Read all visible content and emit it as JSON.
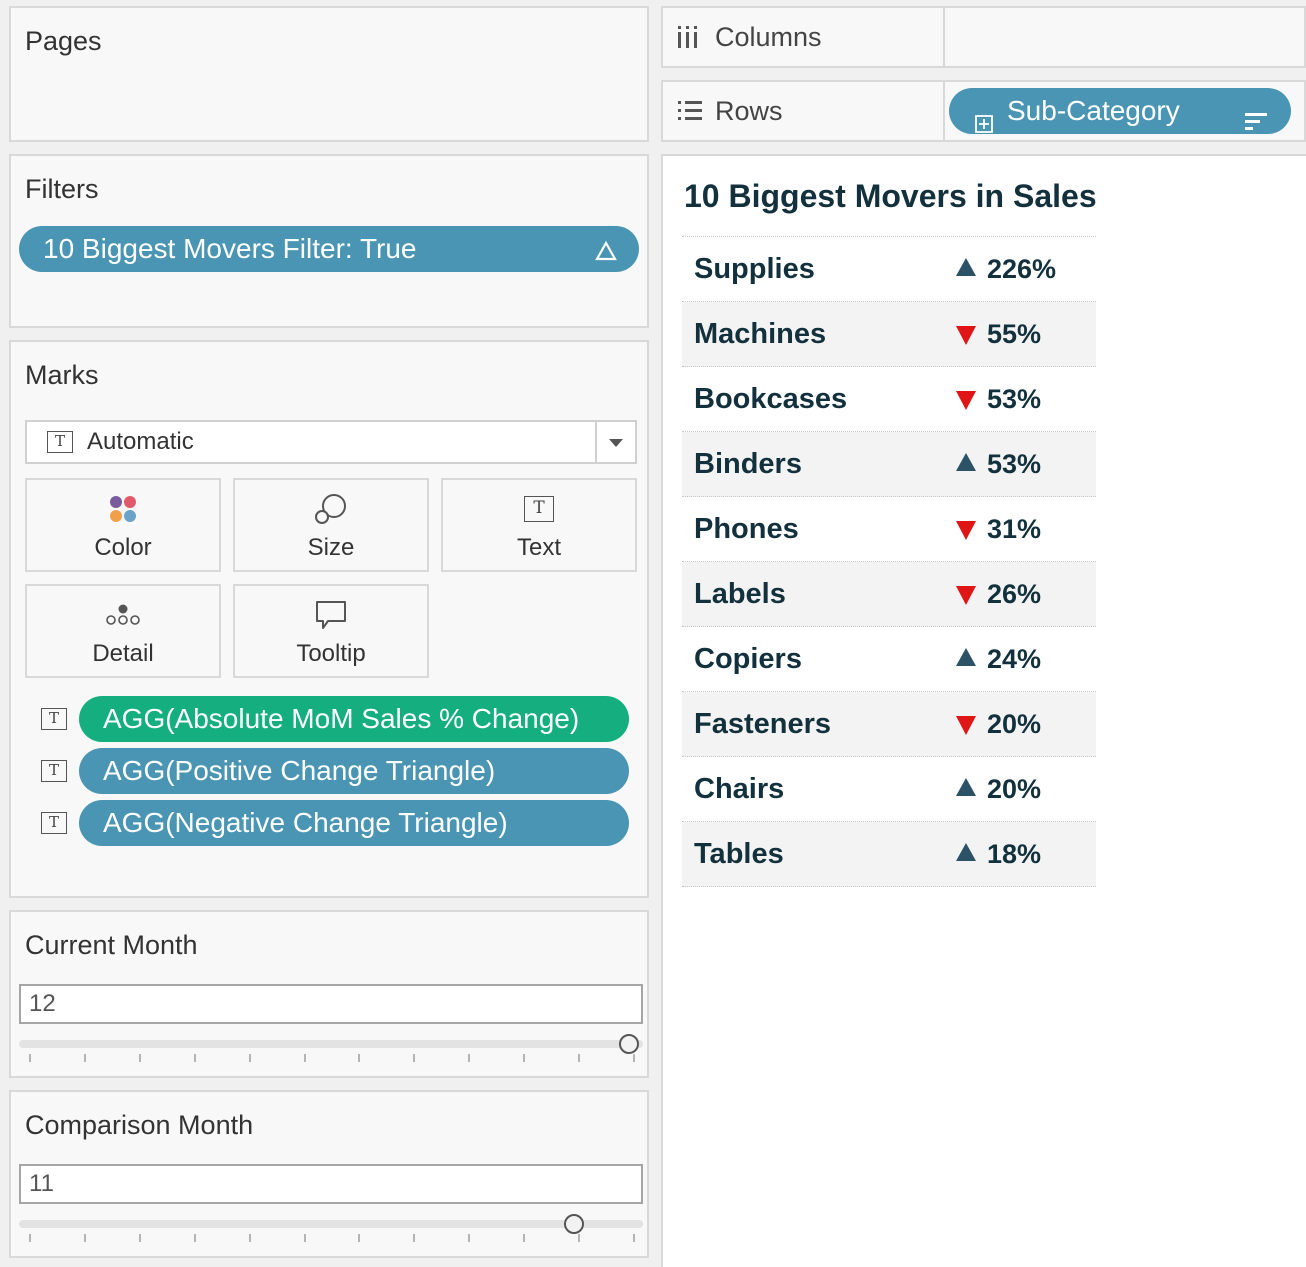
{
  "pages": {
    "title": "Pages"
  },
  "filters": {
    "title": "Filters",
    "pill_label": "10 Biggest Movers Filter: True",
    "pill_icon": "delta-icon"
  },
  "marks": {
    "title": "Marks",
    "mark_type": "Automatic",
    "buttons": {
      "color": "Color",
      "size": "Size",
      "text": "Text",
      "detail": "Detail",
      "tooltip": "Tooltip"
    },
    "fields": [
      {
        "label": "AGG(Absolute MoM Sales % Change)",
        "color": "#15ae7e"
      },
      {
        "label": "AGG(Positive Change Triangle)",
        "color": "#4a95b3"
      },
      {
        "label": "AGG(Negative Change Triangle)",
        "color": "#4a95b3"
      }
    ]
  },
  "current_month": {
    "title": "Current Month",
    "value": "12",
    "level": 1.0
  },
  "comparison_month": {
    "title": "Comparison Month",
    "value": "11",
    "level": 0.909
  },
  "shelves": {
    "columns_label": "Columns",
    "rows_label": "Rows",
    "rows_pill": "Sub-Category"
  },
  "viz": {
    "title": "10 Biggest Movers in Sales",
    "colors": {
      "up": "#2b5266",
      "down": "#e01515"
    },
    "rows": [
      {
        "category": "Supplies",
        "direction": "up",
        "change": "226%"
      },
      {
        "category": "Machines",
        "direction": "down",
        "change": "55%"
      },
      {
        "category": "Bookcases",
        "direction": "down",
        "change": "53%"
      },
      {
        "category": "Binders",
        "direction": "up",
        "change": "53%"
      },
      {
        "category": "Phones",
        "direction": "down",
        "change": "31%"
      },
      {
        "category": "Labels",
        "direction": "down",
        "change": "26%"
      },
      {
        "category": "Copiers",
        "direction": "up",
        "change": "24%"
      },
      {
        "category": "Fasteners",
        "direction": "down",
        "change": "20%"
      },
      {
        "category": "Chairs",
        "direction": "up",
        "change": "20%"
      },
      {
        "category": "Tables",
        "direction": "up",
        "change": "18%"
      }
    ]
  }
}
